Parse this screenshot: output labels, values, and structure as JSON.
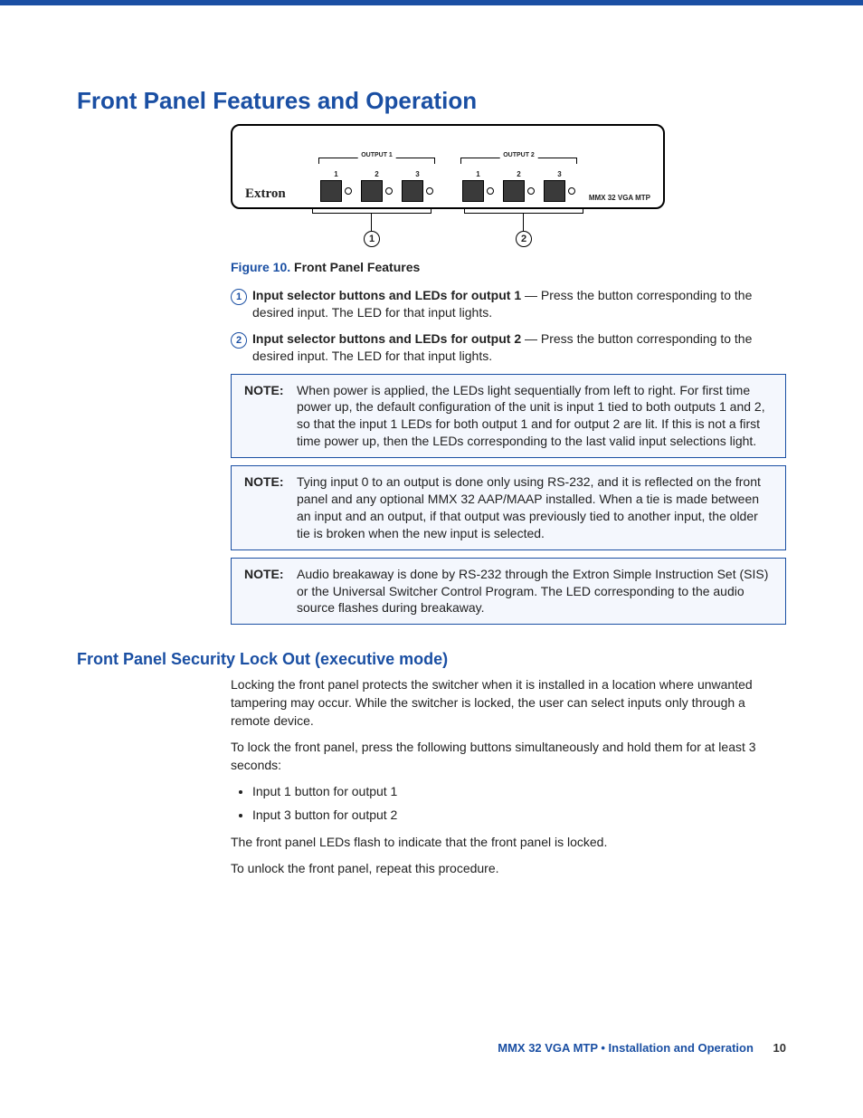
{
  "heading": "Front Panel Features and Operation",
  "panel": {
    "brand": "Extron",
    "model": "MMX 32 VGA MTP",
    "groups": [
      {
        "label": "OUTPUT 1",
        "buttons": [
          "1",
          "2",
          "3"
        ]
      },
      {
        "label": "OUTPUT 2",
        "buttons": [
          "1",
          "2",
          "3"
        ]
      }
    ],
    "leaders": [
      "1",
      "2"
    ]
  },
  "figure": {
    "label": "Figure 10.",
    "title": "Front Panel Features"
  },
  "callouts": [
    {
      "num": "1",
      "bold": "Input selector buttons and LEDs for output 1",
      "rest": " — Press the button corresponding to the desired input. The LED for that input lights."
    },
    {
      "num": "2",
      "bold": "Input selector buttons and LEDs for output 2",
      "rest": " — Press the button corresponding to the desired input. The LED for that input lights."
    }
  ],
  "notes": [
    {
      "label": "NOTE:",
      "text": "When power is applied, the LEDs light sequentially from left to right. For first time power up, the default configuration of the unit is input 1 tied to both outputs 1 and 2, so that the input 1 LEDs for both output 1 and for output 2 are lit. If this is not a first time power up, then the LEDs corresponding to the last valid input selections light."
    },
    {
      "label": "NOTE:",
      "text": "Tying input 0 to an output is done only using RS-232, and it is reflected on the front panel and any optional MMX 32 AAP/MAAP installed. When a tie is made between an input and an output, if that output was previously tied to another input, the older tie is broken when the new input is selected."
    },
    {
      "label": "NOTE:",
      "text": "Audio breakaway is done by RS-232 through the Extron Simple Instruction Set (SIS) or the Universal Switcher Control Program. The LED corresponding to the audio source flashes during breakaway."
    }
  ],
  "subheading": "Front Panel Security Lock Out (executive mode)",
  "lockout": {
    "p1": "Locking the front panel protects the switcher when it is installed in a location where unwanted tampering may occur. While the switcher is locked, the user can select inputs only through a remote device.",
    "p2": "To lock the front panel, press the following buttons simultaneously and hold them for at least 3 seconds:",
    "bullets": [
      "Input 1 button for output 1",
      "Input 3 button for output 2"
    ],
    "p3": "The front panel LEDs flash to indicate that the front panel is locked.",
    "p4": "To unlock the front panel, repeat this procedure."
  },
  "footer": {
    "title": "MMX 32 VGA MTP • Installation and Operation",
    "page": "10"
  }
}
